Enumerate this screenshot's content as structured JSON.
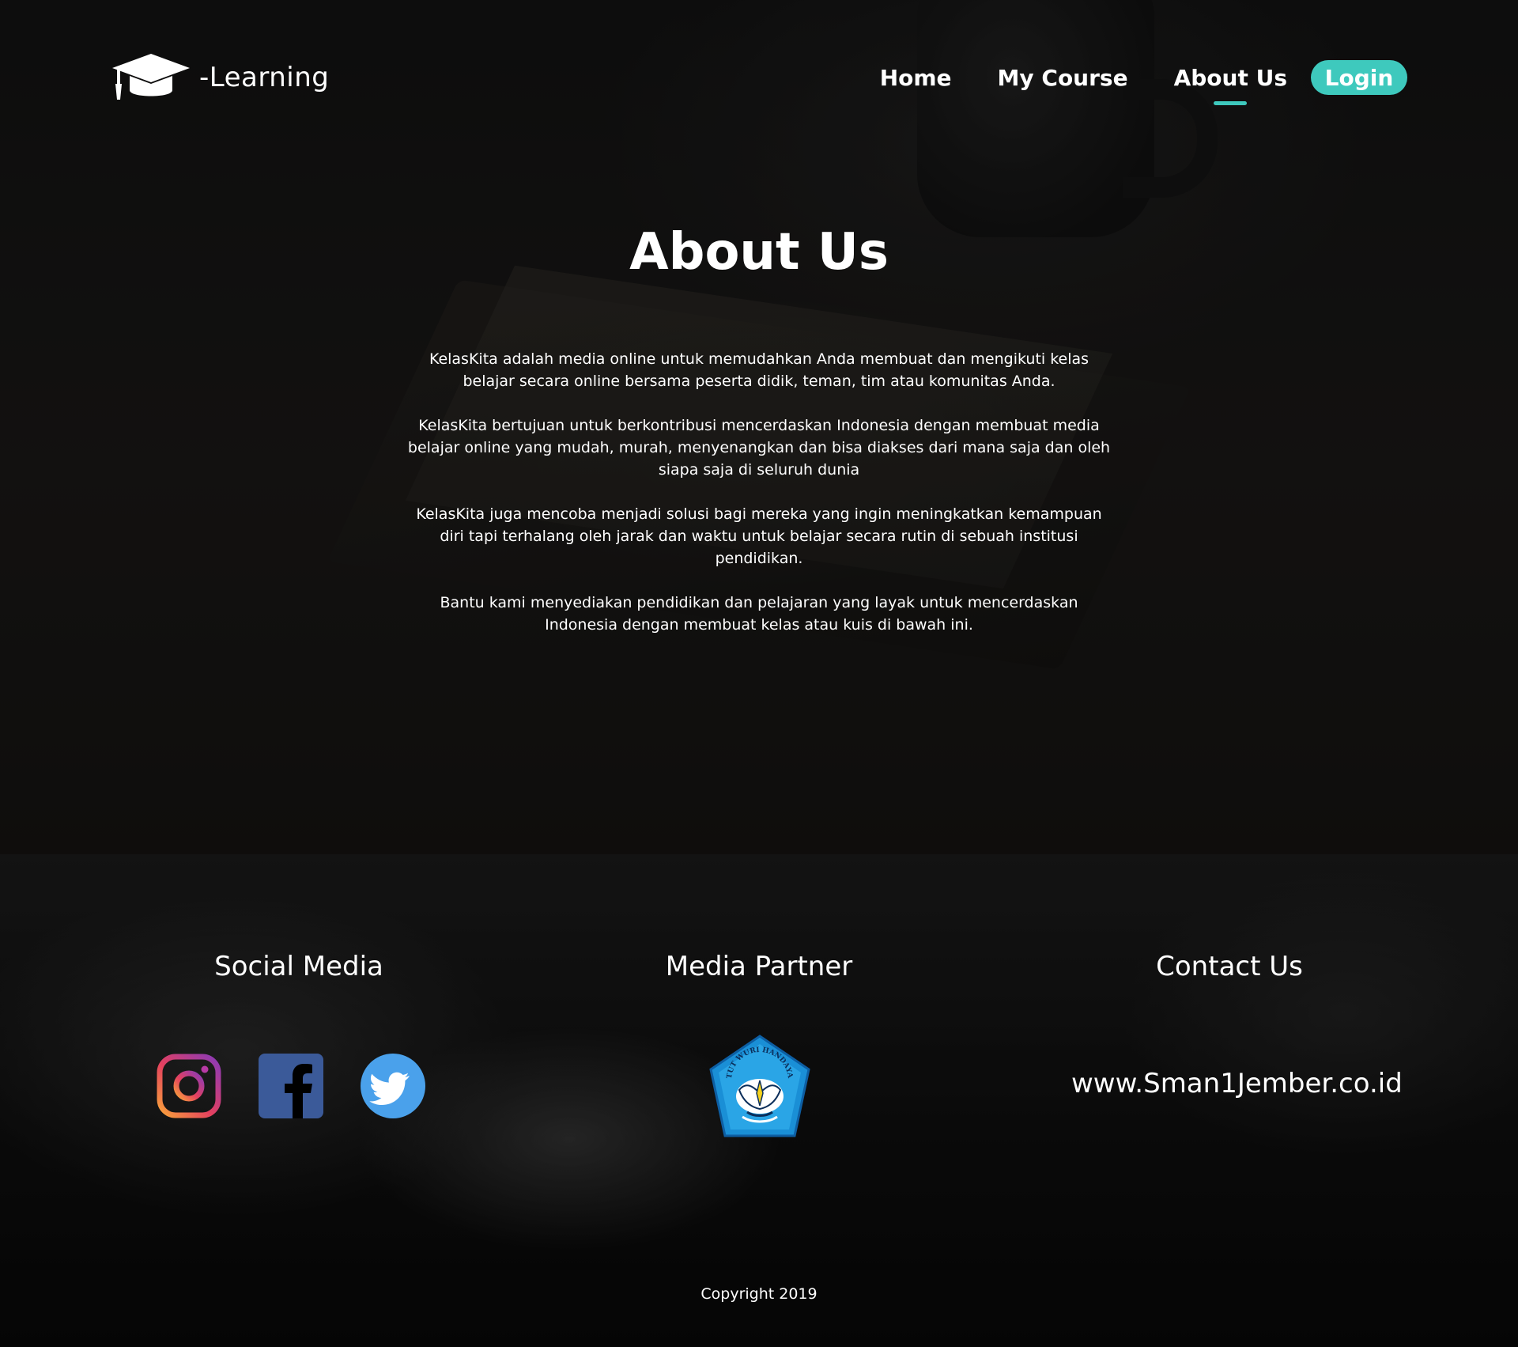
{
  "colors": {
    "accent": "#3ec9bd",
    "text": "#ffffff",
    "background": "#0b0b0b"
  },
  "brand": {
    "text": "-Learning",
    "icon": "graduation-cap-icon"
  },
  "nav": {
    "items": [
      {
        "label": "Home",
        "active": false
      },
      {
        "label": "My Course",
        "active": false
      },
      {
        "label": "About Us",
        "active": true
      }
    ],
    "login_label": "Login"
  },
  "about": {
    "title": "About Us",
    "paragraphs": [
      "KelasKita adalah media online untuk memudahkan Anda membuat dan mengikuti kelas belajar secara online bersama peserta didik, teman, tim atau komunitas Anda.",
      "KelasKita bertujuan untuk berkontribusi mencerdaskan Indonesia dengan membuat media belajar online yang mudah, murah, menyenangkan dan bisa diakses dari mana saja dan oleh siapa saja di seluruh dunia",
      "KelasKita juga mencoba menjadi solusi bagi mereka yang ingin meningkatkan kemampuan diri tapi terhalang oleh jarak dan waktu untuk belajar secara rutin di sebuah institusi pendidikan.",
      "Bantu kami menyediakan pendidikan dan pelajaran yang layak untuk mencerdaskan Indonesia dengan membuat kelas atau kuis di bawah ini."
    ]
  },
  "footer": {
    "social_heading": "Social Media",
    "social_icons": [
      "instagram-icon",
      "facebook-icon",
      "twitter-icon"
    ],
    "partner_heading": "Media Partner",
    "partner_logo": "tut-wuri-handayani-logo",
    "partner_logo_text": "TUT WURI HANDAYANI",
    "contact_heading": "Contact Us",
    "contact_url": "www.Sman1Jember.co.id",
    "copyright": "Copyright 2019"
  }
}
